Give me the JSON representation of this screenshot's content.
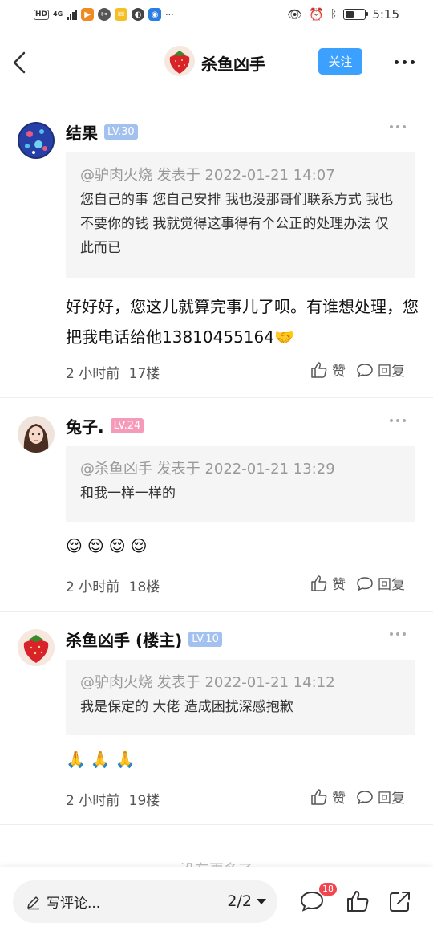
{
  "status_bar": {
    "time": "5:15",
    "network": "4G",
    "hd_label": "HD",
    "battery_level": 0.45,
    "more": "···"
  },
  "header": {
    "title": "杀鱼凶手",
    "follow_label": "关注"
  },
  "comments": [
    {
      "author": "结果",
      "level": "LV.30",
      "level_color": "#a3c1ee",
      "quote_header": "@驴肉火烧 发表于 2022-01-21 14:07",
      "quote_text": "您自己的事 您自己安排 我也没那哥们联系方式 我也不要你的钱 我就觉得这事得有个公正的处理办法 仅此而已",
      "text": "好好好，您这儿就算完事儿了呗。有谁想处理，您把我电话给他13810455164🤝",
      "time": "2 小时前",
      "floor": "17楼",
      "like_label": "赞",
      "reply_label": "回复"
    },
    {
      "author": "兔子.",
      "level": "LV.24",
      "level_color": "#f59ab8",
      "quote_header": "@杀鱼凶手 发表于 2022-01-21 13:29",
      "quote_text": "和我一样一样的",
      "emojis": [
        "😌",
        "😌",
        "😌",
        "😌"
      ],
      "time": "2 小时前",
      "floor": "18楼",
      "like_label": "赞",
      "reply_label": "回复"
    },
    {
      "author": "杀鱼凶手 (楼主)",
      "level": "LV.10",
      "level_color": "#a3c1ee",
      "quote_header": "@驴肉火烧 发表于 2022-01-21 14:12",
      "quote_text": "我是保定的 大佬 造成困扰深感抱歉",
      "emojis": [
        "🙏",
        "🙏",
        "🙏"
      ],
      "time": "2 小时前",
      "floor": "19楼",
      "like_label": "赞",
      "reply_label": "回复"
    }
  ],
  "footer_hint": "没有更多了",
  "bottom_bar": {
    "write_placeholder": "写评论...",
    "page": "2/2",
    "comment_badge": "18"
  }
}
